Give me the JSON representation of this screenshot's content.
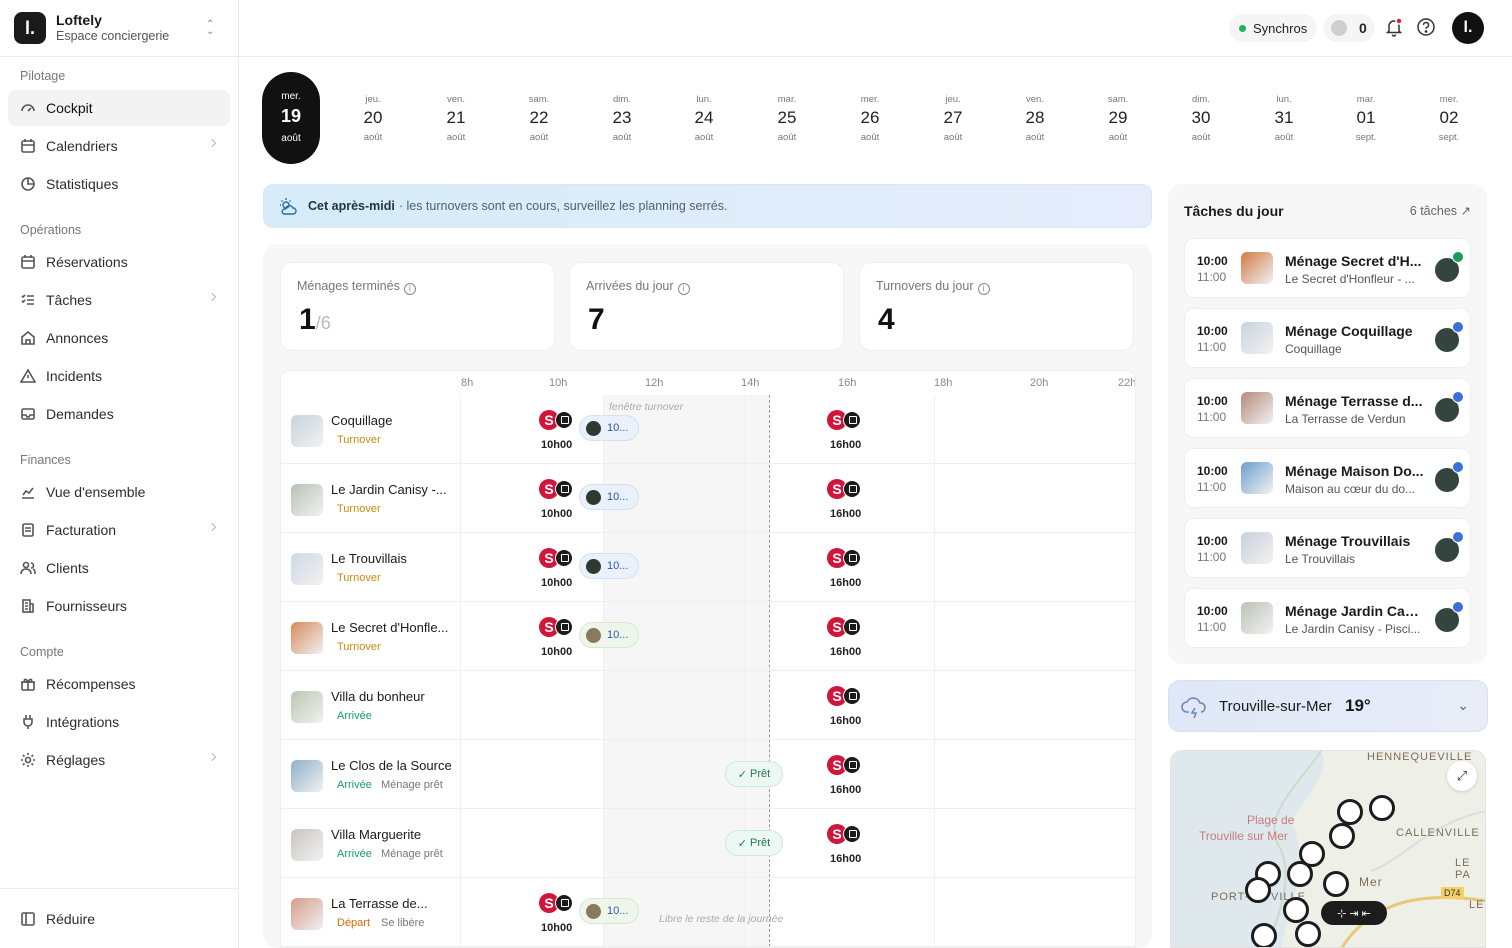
{
  "brand": {
    "name": "Loftely",
    "sub": "Espace conciergerie",
    "logo": "l."
  },
  "sidebar": {
    "sections": [
      "Pilotage",
      "Opérations",
      "Finances",
      "Compte"
    ],
    "items": [
      {
        "label": "Cockpit",
        "icon": "gauge-icon"
      },
      {
        "label": "Calendriers",
        "icon": "calendar-icon"
      },
      {
        "label": "Statistiques",
        "icon": "pie-icon"
      },
      {
        "label": "Réservations",
        "icon": "calendar-check-icon"
      },
      {
        "label": "Tâches",
        "icon": "list-check-icon"
      },
      {
        "label": "Annonces",
        "icon": "home-icon"
      },
      {
        "label": "Incidents",
        "icon": "alert-icon"
      },
      {
        "label": "Demandes",
        "icon": "inbox-icon"
      },
      {
        "label": "Vue d'ensemble",
        "icon": "chart-line-icon"
      },
      {
        "label": "Facturation",
        "icon": "invoice-icon"
      },
      {
        "label": "Clients",
        "icon": "users-icon"
      },
      {
        "label": "Fournisseurs",
        "icon": "building-icon"
      },
      {
        "label": "Récompenses",
        "icon": "gift-icon"
      },
      {
        "label": "Intégrations",
        "icon": "plug-icon"
      },
      {
        "label": "Réglages",
        "icon": "gear-icon"
      }
    ],
    "reduce": "Réduire"
  },
  "topbar": {
    "sync": "Synchros",
    "coins": "0"
  },
  "dates": {
    "selected": {
      "w": "mer.",
      "n": "19",
      "m": "août"
    },
    "days": [
      {
        "w": "jeu.",
        "n": "20",
        "m": "août"
      },
      {
        "w": "ven.",
        "n": "21",
        "m": "août"
      },
      {
        "w": "sam.",
        "n": "22",
        "m": "août"
      },
      {
        "w": "dim.",
        "n": "23",
        "m": "août"
      },
      {
        "w": "lun.",
        "n": "24",
        "m": "août"
      },
      {
        "w": "mar.",
        "n": "25",
        "m": "août"
      },
      {
        "w": "mer.",
        "n": "26",
        "m": "août"
      },
      {
        "w": "jeu.",
        "n": "27",
        "m": "août"
      },
      {
        "w": "ven.",
        "n": "28",
        "m": "août"
      },
      {
        "w": "sam.",
        "n": "29",
        "m": "août"
      },
      {
        "w": "dim.",
        "n": "30",
        "m": "août"
      },
      {
        "w": "lun.",
        "n": "31",
        "m": "août"
      },
      {
        "w": "mar.",
        "n": "01",
        "m": "sept."
      },
      {
        "w": "mer.",
        "n": "02",
        "m": "sept."
      }
    ]
  },
  "banner": {
    "bold": "Cet après-midi",
    "text": "· les turnovers sont en cours, surveillez les planning serrés."
  },
  "kpis": [
    {
      "label": "Ménages terminés",
      "value": "1",
      "suffix": "/6"
    },
    {
      "label": "Arrivées du jour",
      "value": "7",
      "suffix": ""
    },
    {
      "label": "Turnovers du jour",
      "value": "4",
      "suffix": ""
    }
  ],
  "gantt": {
    "hours": [
      "8h",
      "10h",
      "12h",
      "14h",
      "16h",
      "18h",
      "20h",
      "22h"
    ],
    "window_note": "fenêtre turnover",
    "free_note": "Libre le reste de la journée",
    "rows": [
      {
        "name": "Coquillage",
        "tag": "Turnover",
        "sub": "",
        "out": "10h00",
        "in": "16h00",
        "pill": "10..."
      },
      {
        "name": "Le Jardin Canisy -...",
        "tag": "Turnover",
        "sub": "",
        "out": "10h00",
        "in": "16h00",
        "pill": "10..."
      },
      {
        "name": "Le Trouvillais",
        "tag": "Turnover",
        "sub": "",
        "out": "10h00",
        "in": "16h00",
        "pill": "10..."
      },
      {
        "name": "Le Secret d'Honfle...",
        "tag": "Turnover",
        "sub": "",
        "out": "10h00",
        "in": "16h00",
        "pill": "10..."
      },
      {
        "name": "Villa du bonheur",
        "tag": "Arrivée",
        "sub": "",
        "out": "",
        "in": "16h00",
        "pill": ""
      },
      {
        "name": "Le Clos de la Source",
        "tag": "Arrivée",
        "sub": "Ménage prêt",
        "out": "",
        "in": "16h00",
        "pill": "",
        "ready": "Prêt"
      },
      {
        "name": "Villa Marguerite",
        "tag": "Arrivée",
        "sub": "Ménage prêt",
        "out": "",
        "in": "16h00",
        "pill": "",
        "ready": "Prêt"
      },
      {
        "name": "La Terrasse de...",
        "tag": "Départ",
        "sub": "Se libère",
        "out": "10h00",
        "in": "",
        "pill": "10..."
      }
    ]
  },
  "tasks": {
    "title": "Tâches du jour",
    "count": "6 tâches",
    "items": [
      {
        "start": "10:00",
        "end": "11:00",
        "title": "Ménage Secret d'H...",
        "sub": "Le Secret d'Honfleur - ..."
      },
      {
        "start": "10:00",
        "end": "11:00",
        "title": "Ménage Coquillage",
        "sub": "Coquillage"
      },
      {
        "start": "10:00",
        "end": "11:00",
        "title": "Ménage Terrasse d...",
        "sub": "La Terrasse de Verdun"
      },
      {
        "start": "10:00",
        "end": "11:00",
        "title": "Ménage Maison Do...",
        "sub": "Maison au cœur du do..."
      },
      {
        "start": "10:00",
        "end": "11:00",
        "title": "Ménage Trouvillais",
        "sub": "Le Trouvillais"
      },
      {
        "start": "10:00",
        "end": "11:00",
        "title": "Ménage Jardin Can...",
        "sub": "Le Jardin Canisy - Pisci..."
      }
    ]
  },
  "weather": {
    "city": "Trouville-sur-Mer",
    "temp": "19°"
  },
  "map": {
    "labels": [
      "HENNEQUEVILLE",
      "Plage de",
      "Trouville sur Mer",
      "CALLENVILLE",
      "LE PA",
      "PORT-",
      "VILLE",
      "Mer",
      "D74",
      "LE"
    ]
  }
}
